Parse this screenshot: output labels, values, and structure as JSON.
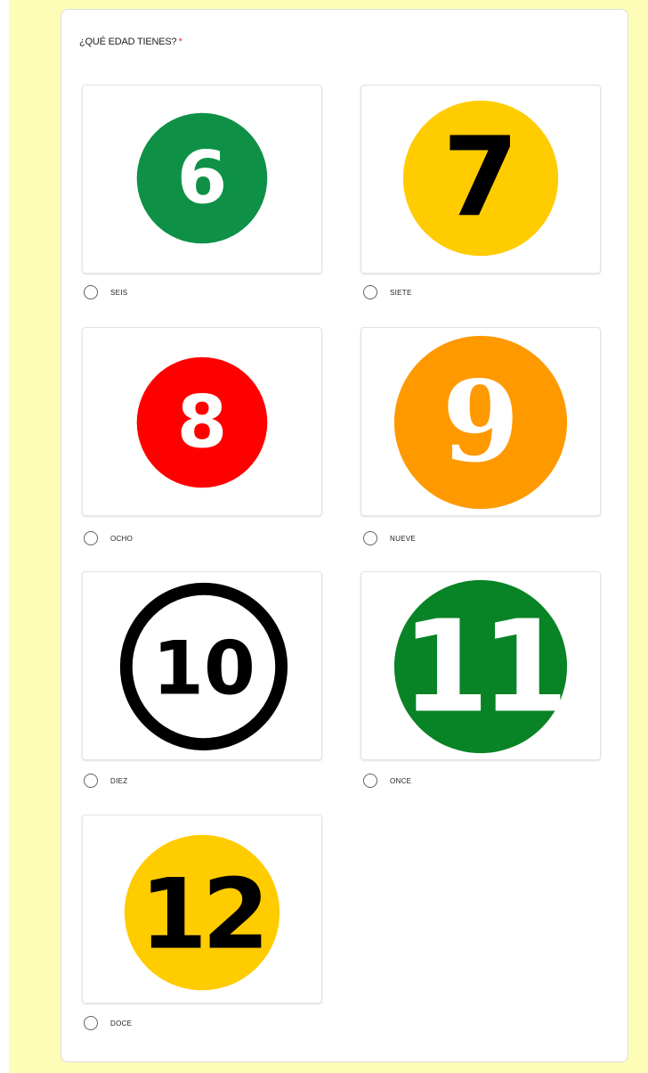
{
  "question": {
    "title": "¿QUÉ EDAD TIENES?",
    "required_mark": "*"
  },
  "options": [
    {
      "label": "SEIS",
      "number": "6",
      "circle_color": "#0e9146",
      "text_color": "#ffffff",
      "style": "filled"
    },
    {
      "label": "SIETE",
      "number": "7",
      "circle_color": "#ffcc00",
      "text_color": "#000000",
      "style": "filled"
    },
    {
      "label": "OCHO",
      "number": "8",
      "circle_color": "#ff0000",
      "text_color": "#ffffff",
      "style": "filled"
    },
    {
      "label": "NUEVE",
      "number": "9",
      "circle_color": "#ff9900",
      "text_color": "#ffffff",
      "style": "filled"
    },
    {
      "label": "DIEZ",
      "number": "10",
      "circle_color": "#000000",
      "text_color": "#000000",
      "style": "outlined"
    },
    {
      "label": "ONCE",
      "number": "11",
      "circle_color": "#088325",
      "text_color": "#ffffff",
      "style": "filled"
    },
    {
      "label": "DOCE",
      "number": "12",
      "circle_color": "#ffcc00",
      "text_color": "#000000",
      "style": "filled"
    }
  ],
  "colors": {
    "page_background": "#fdfdb8",
    "card_background": "#ffffff",
    "required": "#d93025"
  }
}
